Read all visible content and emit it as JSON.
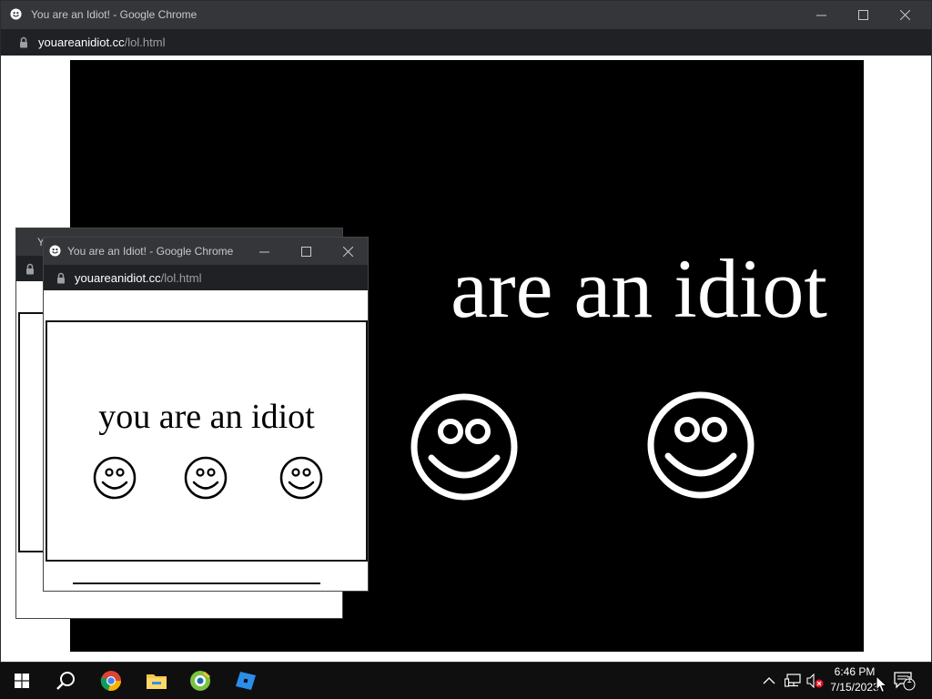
{
  "window": {
    "title": "You are an Idiot! - Google Chrome",
    "url_domain": "youareanidiot.cc",
    "url_path": "/lol.html"
  },
  "page": {
    "big_text": "are an idiot",
    "small_text": "you are an idiot",
    "background_color": "#000000",
    "text_color": "#ffffff"
  },
  "popup": {
    "title": "You are an Idiot! - Google Chrome",
    "url_domain": "youareanidiot.cc",
    "url_path": "/lol.html"
  },
  "popup_back": {
    "title": "Yo"
  },
  "taskbar": {
    "icons": [
      "windows-start-icon",
      "search-icon",
      "chrome-icon",
      "file-explorer-icon",
      "greenshot-icon",
      "roblox-icon"
    ],
    "tray_icons": [
      "chevron-up-icon",
      "network-icon",
      "volume-muted-icon"
    ],
    "time": "6:46 PM",
    "date": "7/15/2023",
    "notification_count": "1"
  },
  "colors": {
    "titlebar": "#35363a",
    "addressbar": "#202124",
    "taskbar": "#0f0f10"
  }
}
